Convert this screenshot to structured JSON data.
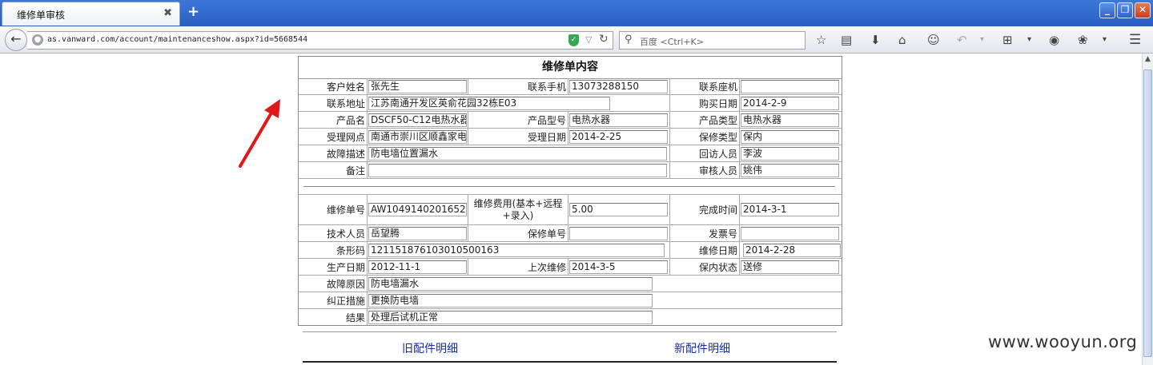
{
  "browser": {
    "tab_title": "维修单审核",
    "tab_close": "✖",
    "new_tab": "+",
    "url": "as.vanward.com/account/maintenanceshow.aspx?id=5668544",
    "search_placeholder": "百度 <Ctrl+K>",
    "window_buttons": {
      "minimize": "_",
      "maximize": "❐",
      "close": "✕"
    }
  },
  "form": {
    "title": "维修单内容",
    "labels": {
      "customer_name": "客户姓名",
      "mobile": "联系手机",
      "landline": "联系座机",
      "address": "联系地址",
      "purchase_date": "购买日期",
      "product_name": "产品名",
      "product_model": "产品型号",
      "product_type": "产品类型",
      "service_point": "受理网点",
      "accept_date": "受理日期",
      "warranty_type": "保修类型",
      "fault_desc": "故障描述",
      "return_visitor": "回访人员",
      "remarks": "备注",
      "auditor": "审核人员",
      "repair_no": "维修单号",
      "repair_fee": "维修费用(基本+远程+录入)",
      "finish_time": "完成时间",
      "technician": "技术人员",
      "warranty_no": "保修单号",
      "invoice_no": "发票号",
      "barcode": "条形码",
      "repair_date": "维修日期",
      "production_date": "生产日期",
      "last_repair": "上次维修",
      "warranty_status": "保内状态",
      "fault_cause": "故障原因",
      "corrective_action": "纠正措施",
      "result": "结果"
    },
    "values": {
      "customer_name": "张先生",
      "mobile": "13073288150",
      "landline": "",
      "address": "江苏南通开发区英俞花园32栋E03",
      "purchase_date": "2014-2-9",
      "product_name": "DSCF50-C12电热水器",
      "product_model": "电热水器",
      "product_type": "电热水器",
      "service_point": "南通市崇川区顺鑫家电",
      "accept_date": "2014-2-25",
      "warranty_type": "保内",
      "fault_desc": "防电墙位置漏水",
      "return_visitor": "李波",
      "remarks": "",
      "auditor": "姚伟",
      "repair_no": "AW1049140201652",
      "repair_fee": "5.00",
      "finish_time": "2014-3-1",
      "technician": "岳望腾",
      "warranty_no": "",
      "invoice_no": "",
      "barcode": "121151876103010500163",
      "repair_date": "2014-2-28",
      "production_date": "2012-11-1",
      "last_repair": "2014-3-5",
      "warranty_status": "送修",
      "fault_cause": "防电墙漏水",
      "corrective_action": "更换防电墙",
      "result": "处理后试机正常"
    }
  },
  "links": {
    "old_parts": "旧配件明细",
    "new_parts": "新配件明细"
  },
  "watermark": "www.wooyun.org"
}
